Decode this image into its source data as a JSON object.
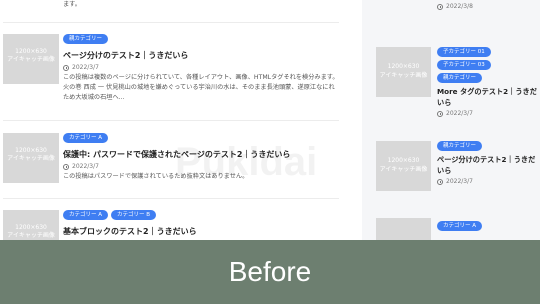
{
  "top_excerpt_tail": "ます。",
  "thumbnail_text": "1200×630\nアイキャッチ画像",
  "watermark": "Pukidai",
  "posts": [
    {
      "badges": [
        "親カテゴリー"
      ],
      "title": "ページ分けのテスト2｜うきだいら",
      "date": "2022/3/7",
      "excerpt": "この投稿は複数のページに分けられていて、各種レイアウト、画像、HTMLタグそれを検分みます。 火の巻 西成 一 伏見桃山の城地を嫌めぐっている宇治川の水は、そのまま長池頭蒙、遂原江なにれため大坂城の石垣へ..."
    },
    {
      "badges": [
        "カテゴリー A"
      ],
      "title": "保護中: パスワードで保護されたページのテスト2｜うきだいら",
      "date": "2022/3/7",
      "excerpt": "この投稿はパスワードで保護されているため抜粋文はありません。"
    },
    {
      "badges": [
        "カテゴリー A",
        "カテゴリー B"
      ],
      "title": "基本ブロックのテスト2｜うきだいら",
      "date": "",
      "excerpt": ""
    }
  ],
  "sidebar": {
    "top_date": "2022/3/8",
    "posts": [
      {
        "badges": [
          "子カテゴリー 01",
          "子カテゴリー 03",
          "親カテゴリー"
        ],
        "title": "More タグのテスト2｜うきだいら",
        "date": "2022/3/7"
      },
      {
        "badges": [
          "親カテゴリー"
        ],
        "title": "ページ分けのテスト2｜うきだいら",
        "date": "2022/3/7"
      },
      {
        "badges": [
          "カテゴリー A"
        ],
        "title": "",
        "date": ""
      }
    ]
  },
  "banner": {
    "label": "Before"
  },
  "colors": {
    "badge": "#3f7ef2",
    "banner": "#6d7f70",
    "sidebar": "#f5f6f8"
  }
}
